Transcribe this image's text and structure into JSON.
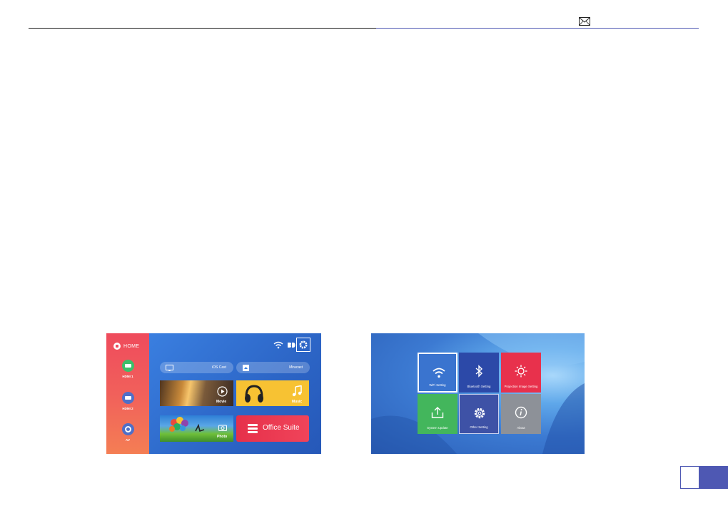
{
  "header": {
    "mail_icon": "envelope-icon"
  },
  "home_screen": {
    "logo_label": "HOME",
    "sources": [
      {
        "label": "HDMI 1",
        "icon": "hdmi-icon",
        "color": "#3cbf6a"
      },
      {
        "label": "HDMI 2",
        "icon": "hdmi-icon",
        "color": "#4f6fc8"
      },
      {
        "label": "AV",
        "icon": "av-icon",
        "color": "#4f6fc8"
      }
    ],
    "status_icons": [
      "wifi-icon",
      "bluetooth-icon",
      "gear-icon"
    ],
    "pills": [
      {
        "label": "iOS Cast",
        "icon": "screen-cast-icon"
      },
      {
        "label": "Miracast",
        "icon": "miracast-icon"
      }
    ],
    "tiles": [
      {
        "label": "Movie",
        "icon": "play-icon"
      },
      {
        "label": "Music",
        "icon": "music-note-icon"
      },
      {
        "label": "Photo",
        "icon": "camera-icon"
      },
      {
        "label": "Office Suite",
        "icon": "stack-icon"
      }
    ]
  },
  "settings_screen": {
    "tiles": [
      {
        "label": "WiFi Setting",
        "icon": "wifi-icon",
        "color": "#3a74cf",
        "selected": true
      },
      {
        "label": "Bluetooth Setting",
        "icon": "bluetooth-icon",
        "color": "#2c49a8",
        "selected": false
      },
      {
        "label": "Projection Image Setting",
        "icon": "brightness-icon",
        "color": "#e8314c",
        "selected": false
      },
      {
        "label": "System Update",
        "icon": "upload-icon",
        "color": "#43b65c",
        "selected": false
      },
      {
        "label": "Other Setting",
        "icon": "gear-icon",
        "color": "#3e52a6",
        "selected": false
      },
      {
        "label": "About",
        "icon": "info-icon",
        "color": "#8d9198",
        "selected": false
      }
    ]
  },
  "page_tab": {
    "color": "#4e58b3"
  }
}
